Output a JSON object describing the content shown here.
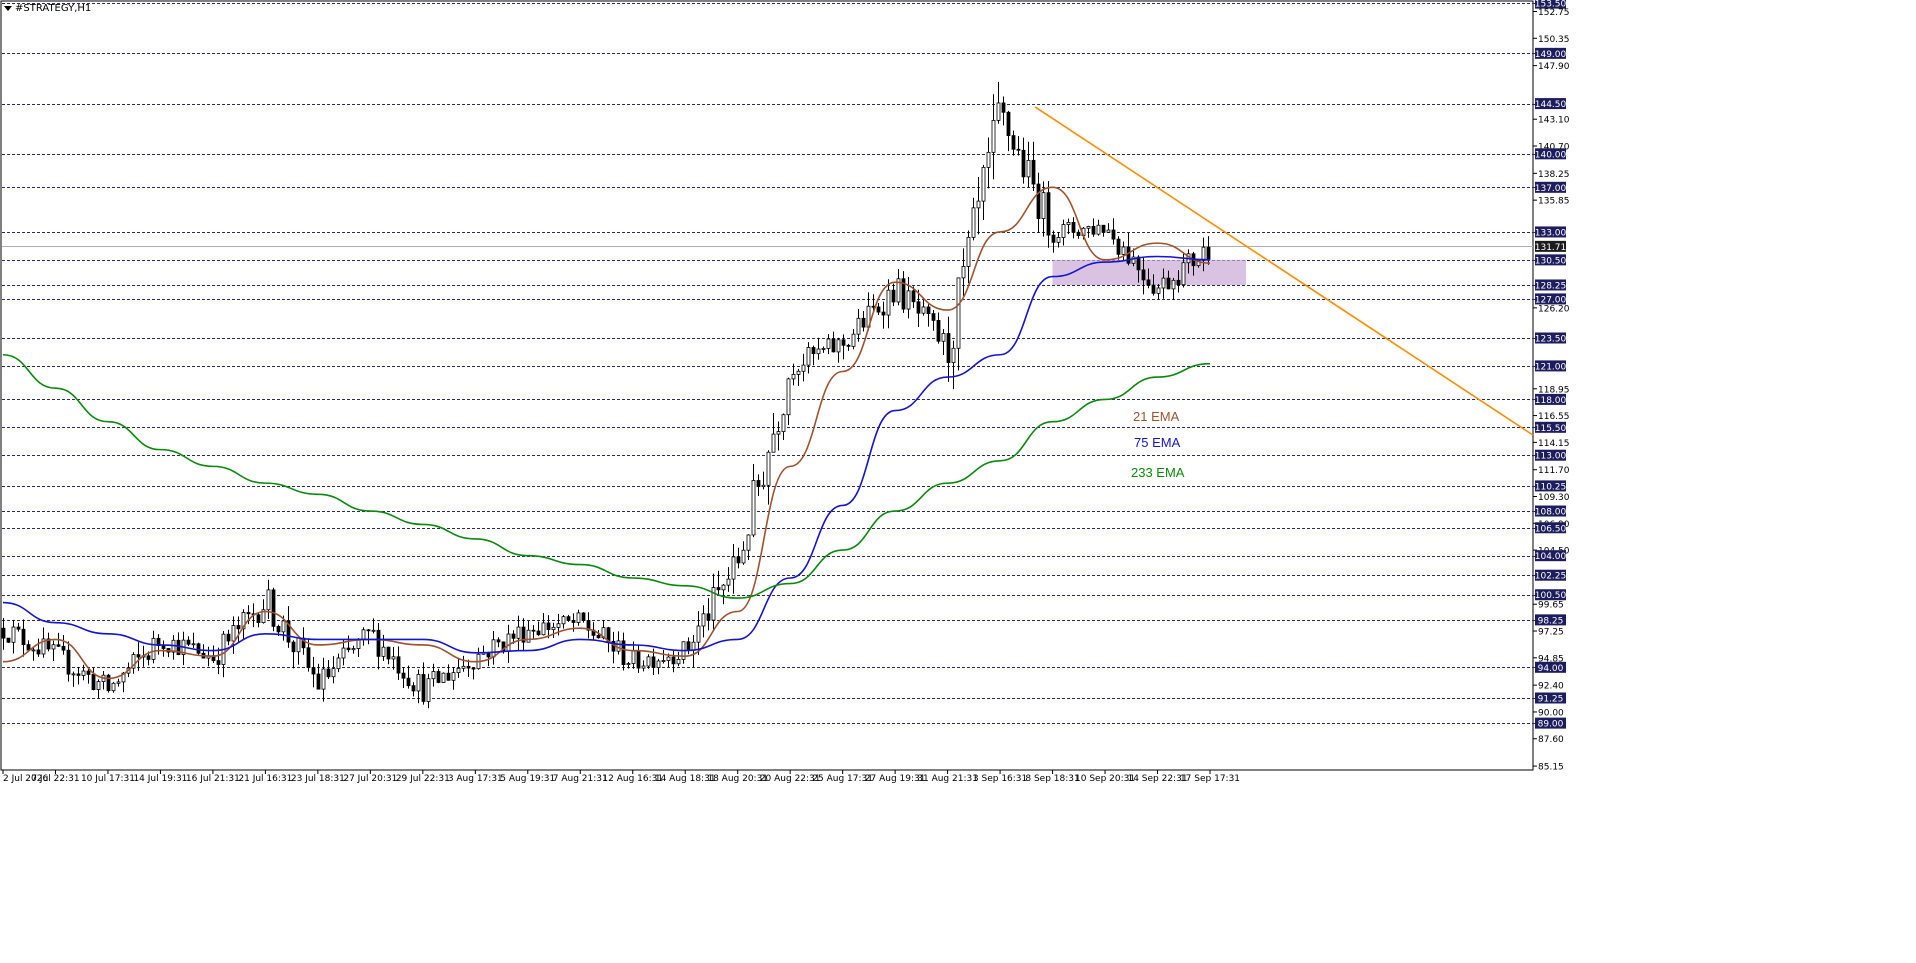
{
  "window": {
    "symbol_label": "#STRATEGY,H1"
  },
  "colors": {
    "candle": "#000000",
    "grid": "#2b2b5a",
    "ema21": "#a0522d",
    "ema75": "#1414d2",
    "ema233": "#0a8a0a",
    "trendline": "#ff8c00",
    "zone": "#c9a8d6",
    "level_box": "#1c1c5e",
    "current_box": "#1c1c1c"
  },
  "legend": [
    {
      "text": "21 EMA",
      "color_key": "ema21"
    },
    {
      "text": "75 EMA",
      "color_key": "ema75"
    },
    {
      "text": "233 EMA",
      "color_key": "ema233"
    }
  ],
  "chart_data": {
    "type": "candlestick",
    "timeframe": "H1",
    "ylim": [
      84.8,
      153.6
    ],
    "x_tick_labels": [
      "2 Jul 2026",
      "7 Jul 22:31",
      "10 Jul 17:31",
      "14 Jul 19:31",
      "16 Jul 21:31",
      "21 Jul 16:31",
      "23 Jul 18:31",
      "27 Jul 20:31",
      "29 Jul 22:31",
      "3 Aug 17:31",
      "5 Aug 19:31",
      "7 Aug 21:31",
      "12 Aug 16:31",
      "14 Aug 18:31",
      "18 Aug 20:31",
      "20 Aug 22:31",
      "25 Aug 17:31",
      "27 Aug 19:31",
      "31 Aug 21:31",
      "3 Sep 16:31",
      "8 Sep 18:31",
      "10 Sep 20:31",
      "14 Sep 22:31",
      "17 Sep 17:31"
    ],
    "y_tick_labels": [
      "152.75",
      "150.35",
      "147.90",
      "143.10",
      "140.70",
      "138.25",
      "135.85",
      "126.20",
      "118.95",
      "116.55",
      "114.15",
      "111.70",
      "109.30",
      "106.90",
      "104.50",
      "99.65",
      "97.25",
      "94.85",
      "92.40",
      "90.00",
      "87.60",
      "85.15"
    ],
    "horizontal_levels": [
      153.5,
      149.0,
      144.5,
      140.0,
      137.0,
      133.0,
      130.5,
      128.25,
      127.0,
      123.5,
      121.0,
      118.0,
      115.5,
      113.0,
      110.25,
      108.0,
      106.5,
      104.0,
      102.25,
      100.5,
      98.25,
      94.0,
      91.25,
      89.0
    ],
    "current_price": 131.71,
    "current_price_label": "131.71",
    "trendline": {
      "from": {
        "x_label": "3 Sep 16:31",
        "price": 144.2
      },
      "to": {
        "x_label": "right edge",
        "price": 114.8
      }
    },
    "zone": {
      "price_top": 130.5,
      "price_bottom": 128.25
    },
    "price_path": [
      [
        "2 Jul 2026",
        97.5
      ],
      [
        "7 Jul 22:31",
        95.0
      ],
      [
        "10 Jul 17:31",
        92.0
      ],
      [
        "14 Jul 19:31",
        96.5
      ],
      [
        "16 Jul 21:31",
        95.0
      ],
      [
        "21 Jul 16:31",
        100.0
      ],
      [
        "23 Jul 18:31",
        92.5
      ],
      [
        "27 Jul 20:31",
        97.0
      ],
      [
        "29 Jul 22:31",
        92.0
      ],
      [
        "3 Aug 17:31",
        95.0
      ],
      [
        "5 Aug 19:31",
        97.5
      ],
      [
        "7 Aug 21:31",
        98.0
      ],
      [
        "12 Aug 16:31",
        94.5
      ],
      [
        "14 Aug 18:31",
        95.5
      ],
      [
        "18 Aug 20:31",
        103.5
      ],
      [
        "20 Aug 22:31",
        121.0
      ],
      [
        "25 Aug 17:31",
        123.0
      ],
      [
        "27 Aug 19:31",
        128.0
      ],
      [
        "31 Aug 21:31",
        122.5
      ],
      [
        "3 Sep 16:31",
        143.5
      ],
      [
        "8 Sep 18:31",
        133.0
      ],
      [
        "10 Sep 20:31",
        133.5
      ],
      [
        "14 Sep 22:31",
        128.0
      ],
      [
        "17 Sep 17:31",
        131.7
      ]
    ],
    "series": [
      {
        "name": "21 EMA",
        "color_key": "ema21",
        "points": [
          [
            "2 Jul 2026",
            94.5
          ],
          [
            "7 Jul 22:31",
            96.5
          ],
          [
            "10 Jul 17:31",
            93.0
          ],
          [
            "14 Jul 19:31",
            95.5
          ],
          [
            "16 Jul 21:31",
            95.0
          ],
          [
            "21 Jul 16:31",
            99.0
          ],
          [
            "23 Jul 18:31",
            96.0
          ],
          [
            "27 Jul 20:31",
            96.5
          ],
          [
            "29 Jul 22:31",
            96.0
          ],
          [
            "3 Aug 17:31",
            94.5
          ],
          [
            "5 Aug 19:31",
            96.5
          ],
          [
            "7 Aug 21:31",
            97.5
          ],
          [
            "12 Aug 16:31",
            95.5
          ],
          [
            "14 Aug 18:31",
            95.0
          ],
          [
            "18 Aug 20:31",
            99.0
          ],
          [
            "20 Aug 22:31",
            112.0
          ],
          [
            "25 Aug 17:31",
            120.5
          ],
          [
            "27 Aug 19:31",
            128.5
          ],
          [
            "31 Aug 21:31",
            126.0
          ],
          [
            "3 Sep 16:31",
            133.0
          ],
          [
            "8 Sep 18:31",
            137.0
          ],
          [
            "10 Sep 20:31",
            130.5
          ],
          [
            "14 Sep 22:31",
            132.0
          ],
          [
            "17 Sep 17:31",
            130.2
          ]
        ]
      },
      {
        "name": "75 EMA",
        "color_key": "ema75",
        "points": [
          [
            "2 Jul 2026",
            99.8
          ],
          [
            "7 Jul 22:31",
            98.0
          ],
          [
            "10 Jul 17:31",
            97.0
          ],
          [
            "14 Jul 19:31",
            96.0
          ],
          [
            "16 Jul 21:31",
            95.5
          ],
          [
            "21 Jul 16:31",
            97.0
          ],
          [
            "23 Jul 18:31",
            96.5
          ],
          [
            "27 Jul 20:31",
            96.5
          ],
          [
            "29 Jul 22:31",
            96.5
          ],
          [
            "3 Aug 17:31",
            95.3
          ],
          [
            "5 Aug 19:31",
            95.5
          ],
          [
            "7 Aug 21:31",
            96.5
          ],
          [
            "12 Aug 16:31",
            96.0
          ],
          [
            "14 Aug 18:31",
            95.5
          ],
          [
            "18 Aug 20:31",
            96.5
          ],
          [
            "20 Aug 22:31",
            102.0
          ],
          [
            "25 Aug 17:31",
            108.5
          ],
          [
            "27 Aug 19:31",
            117.0
          ],
          [
            "31 Aug 21:31",
            120.0
          ],
          [
            "3 Sep 16:31",
            122.0
          ],
          [
            "8 Sep 18:31",
            129.0
          ],
          [
            "10 Sep 20:31",
            130.3
          ],
          [
            "14 Sep 22:31",
            130.8
          ],
          [
            "17 Sep 17:31",
            130.5
          ]
        ]
      },
      {
        "name": "233 EMA",
        "color_key": "ema233",
        "points": [
          [
            "2 Jul 2026",
            122.0
          ],
          [
            "7 Jul 22:31",
            119.0
          ],
          [
            "10 Jul 17:31",
            116.0
          ],
          [
            "14 Jul 19:31",
            113.5
          ],
          [
            "16 Jul 21:31",
            112.0
          ],
          [
            "21 Jul 16:31",
            110.5
          ],
          [
            "23 Jul 18:31",
            109.5
          ],
          [
            "27 Jul 20:31",
            108.0
          ],
          [
            "29 Jul 22:31",
            106.8
          ],
          [
            "3 Aug 17:31",
            105.5
          ],
          [
            "5 Aug 19:31",
            104.0
          ],
          [
            "7 Aug 21:31",
            103.2
          ],
          [
            "12 Aug 16:31",
            102.0
          ],
          [
            "14 Aug 18:31",
            101.3
          ],
          [
            "18 Aug 20:31",
            100.2
          ],
          [
            "20 Aug 22:31",
            101.5
          ],
          [
            "25 Aug 17:31",
            104.5
          ],
          [
            "27 Aug 19:31",
            108.0
          ],
          [
            "31 Aug 21:31",
            110.5
          ],
          [
            "3 Sep 16:31",
            112.5
          ],
          [
            "8 Sep 18:31",
            116.0
          ],
          [
            "10 Sep 20:31",
            118.0
          ],
          [
            "14 Sep 22:31",
            120.0
          ],
          [
            "17 Sep 17:31",
            121.2
          ]
        ]
      }
    ]
  }
}
